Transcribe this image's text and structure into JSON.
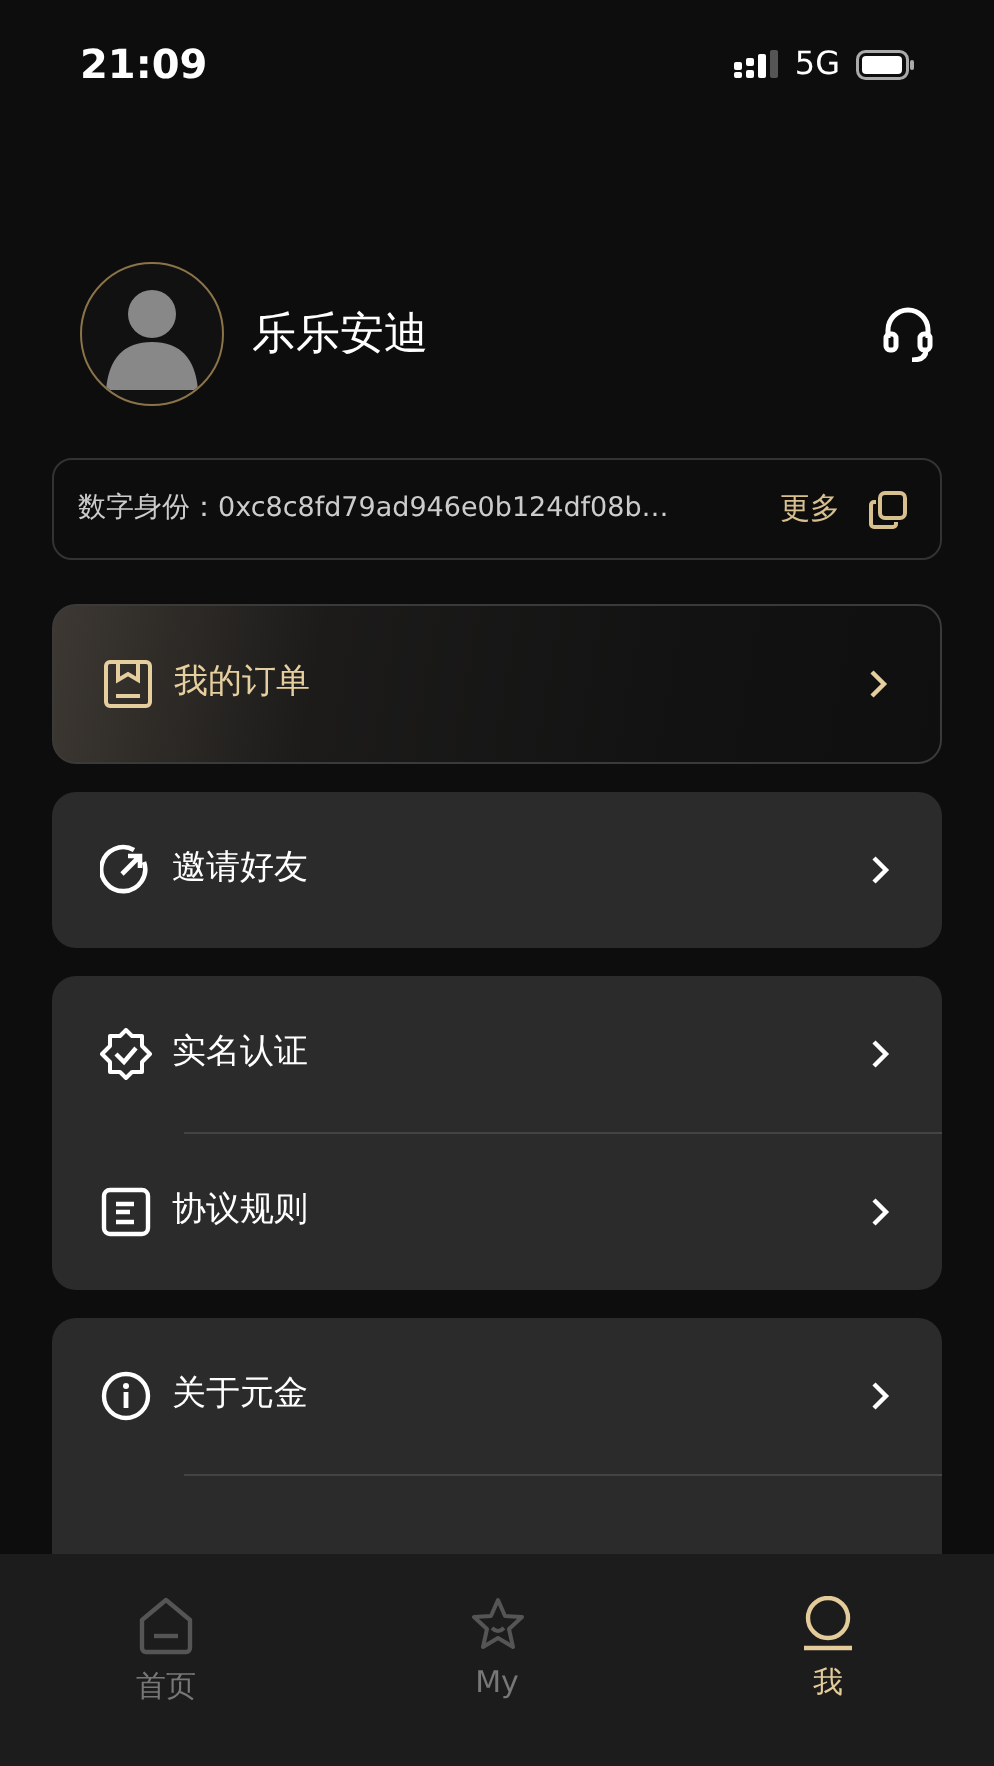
{
  "status_bar": {
    "time": "21:09",
    "network": "5G"
  },
  "profile": {
    "name": "乐乐安迪"
  },
  "identity": {
    "label": "数字身份：",
    "value": "0xc8c8fd79ad946e0b124df08b…",
    "more": "更多"
  },
  "menu_groups": [
    {
      "kind": "featured",
      "rows": [
        {
          "label": "我的订单"
        }
      ]
    },
    {
      "kind": "plain",
      "rows": [
        {
          "label": "邀请好友"
        }
      ]
    },
    {
      "kind": "plain",
      "rows": [
        {
          "label": "实名认证"
        },
        {
          "label": "协议规则"
        }
      ]
    },
    {
      "kind": "plain",
      "rows": [
        {
          "label": "关于元金"
        }
      ]
    }
  ],
  "tabs": [
    {
      "label": "首页",
      "selected": false
    },
    {
      "label": "My",
      "selected": false
    },
    {
      "label": "我",
      "selected": true
    }
  ]
}
